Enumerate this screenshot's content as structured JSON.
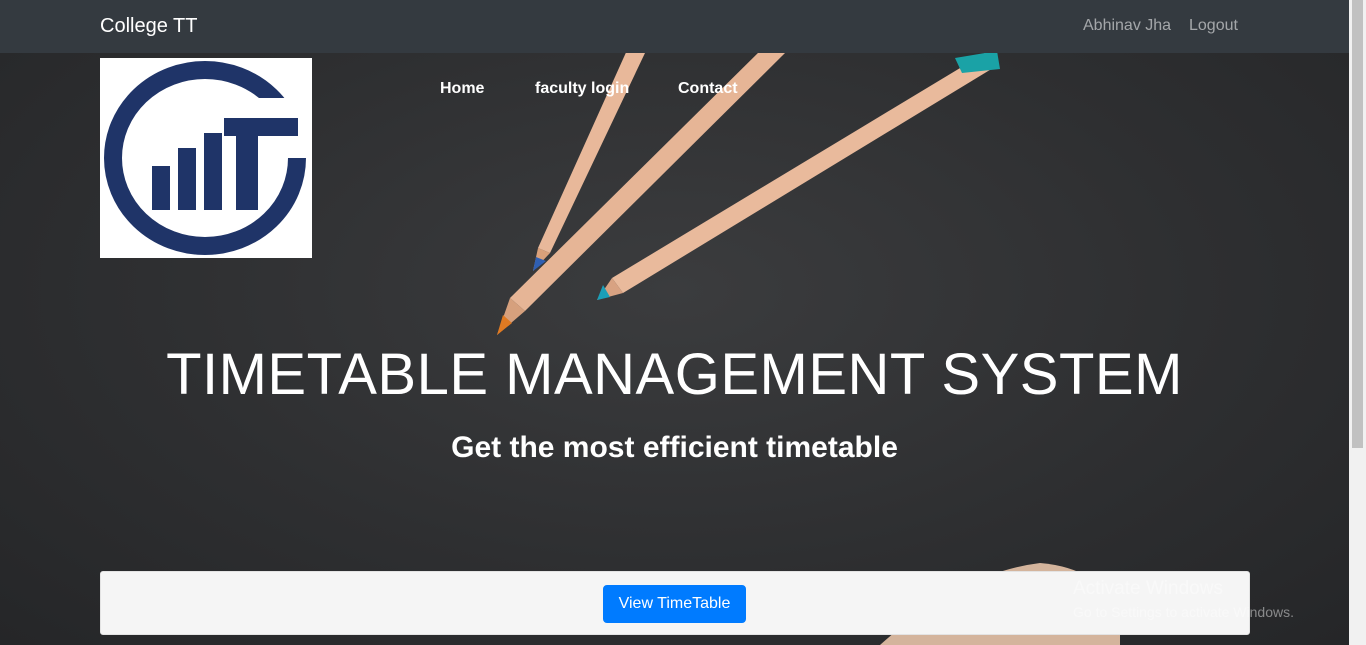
{
  "navbar": {
    "brand": "College TT",
    "user_name": "Abhinav Jha",
    "logout_label": "Logout"
  },
  "nav_links": [
    {
      "label": "Home"
    },
    {
      "label": "faculty login"
    },
    {
      "label": "Contact"
    }
  ],
  "hero": {
    "title": "TIMETABLE MANAGEMENT SYSTEM",
    "subtitle": "Get the most efficient timetable"
  },
  "panel": {
    "button_label": "View TimeTable"
  },
  "watermark": {
    "title": "Activate Windows",
    "subtitle": "Go to Settings to activate Windows."
  },
  "colors": {
    "navbar_bg": "#343a40",
    "primary_button": "#007bff",
    "logo_blue": "#1f3468",
    "panel_bg": "#f5f5f5"
  },
  "icons": {
    "logo": "college-tt-logo-icon"
  }
}
